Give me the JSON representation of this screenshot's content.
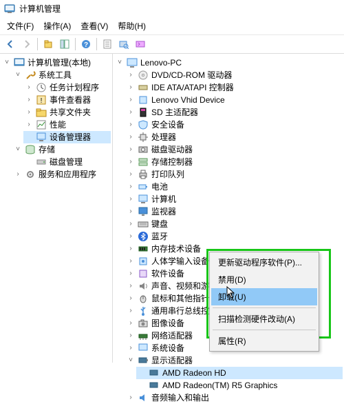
{
  "window": {
    "title": "计算机管理"
  },
  "menu": {
    "file": "文件(F)",
    "action": "操作(A)",
    "view": "查看(V)",
    "help": "帮助(H)"
  },
  "left_tree": {
    "root": "计算机管理(本地)",
    "system_tools": "系统工具",
    "task_scheduler": "任务计划程序",
    "event_viewer": "事件查看器",
    "shared_folders": "共享文件夹",
    "performance": "性能",
    "device_manager": "设备管理器",
    "storage": "存储",
    "disk_management": "磁盘管理",
    "services": "服务和应用程序"
  },
  "right_tree": {
    "root": "Lenovo-PC",
    "dvd": "DVD/CD-ROM 驱动器",
    "ide": "IDE ATA/ATAPI 控制器",
    "vhid": "Lenovo Vhid Device",
    "sd": "SD 主适配器",
    "security": "安全设备",
    "processors": "处理器",
    "disk_drives": "磁盘驱动器",
    "storage_ctrl": "存储控制器",
    "print_queue": "打印队列",
    "battery": "电池",
    "computer": "计算机",
    "monitors": "监视器",
    "keyboards": "键盘",
    "bluetooth": "蓝牙",
    "memory": "内存技术设备",
    "hid": "人体学输入设备",
    "software_dev": "软件设备",
    "sound": "声音、视频和游戏控制器",
    "mice": "鼠标和其他指针设备",
    "usb": "通用串行总线控制器",
    "imaging": "图像设备",
    "network": "网络适配器",
    "system_devices": "系统设备",
    "display_adapters": "显示适配器",
    "gpu1": "AMD Radeon HD",
    "gpu2": "AMD Radeon(TM) R5 Graphics",
    "audio_io": "音频输入和输出"
  },
  "context_menu": {
    "update": "更新驱动程序软件(P)...",
    "disable": "禁用(D)",
    "uninstall": "卸载(U)",
    "scan": "扫描检测硬件改动(A)",
    "properties": "属性(R)"
  }
}
